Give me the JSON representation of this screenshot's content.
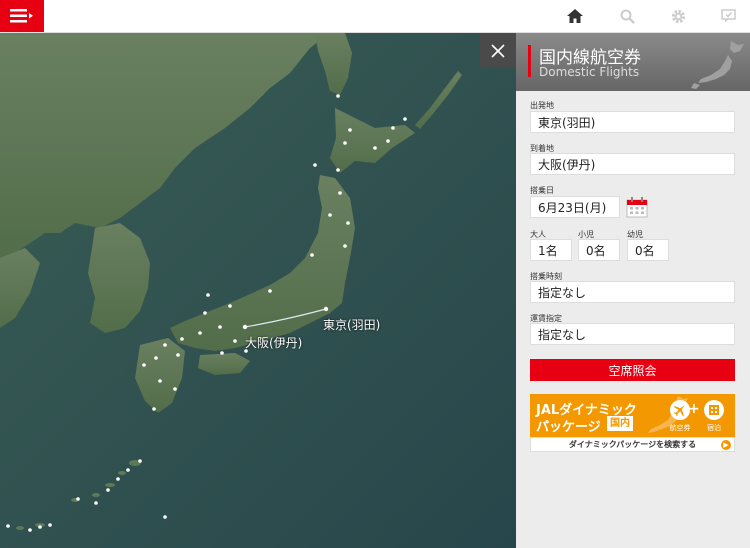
{
  "header": {
    "menu_icon": "menu-icon",
    "icons": [
      "home-icon",
      "search-icon",
      "gear-icon",
      "message-icon"
    ]
  },
  "map": {
    "route_labels": {
      "origin": "東京(羽田)",
      "destination": "大阪(伊丹)"
    }
  },
  "panel": {
    "title": "国内線航空券",
    "subtitle": "Domestic Flights",
    "from_label": "出発地",
    "from_value": "東京(羽田)",
    "to_label": "到着地",
    "to_value": "大阪(伊丹)",
    "date_label": "搭乗日",
    "date_value": "6月23日(月)",
    "adult_label": "大人",
    "adult_value": "1名",
    "child_label": "小児",
    "child_value": "0名",
    "infant_label": "幼児",
    "infant_value": "0名",
    "time_label": "搭乗時刻",
    "time_value": "指定なし",
    "fare_label": "運賃指定",
    "fare_value": "指定なし",
    "search_button": "空席照会"
  },
  "banner": {
    "line1": "JALダイナミック",
    "line2": "パッケージ",
    "badge": "国内",
    "flight_label": "航空券",
    "hotel_label": "宿泊",
    "plus": "+",
    "link_text": "ダイナミックパッケージを検索する"
  },
  "colors": {
    "accent": "#e60012",
    "banner": "#f39800"
  }
}
